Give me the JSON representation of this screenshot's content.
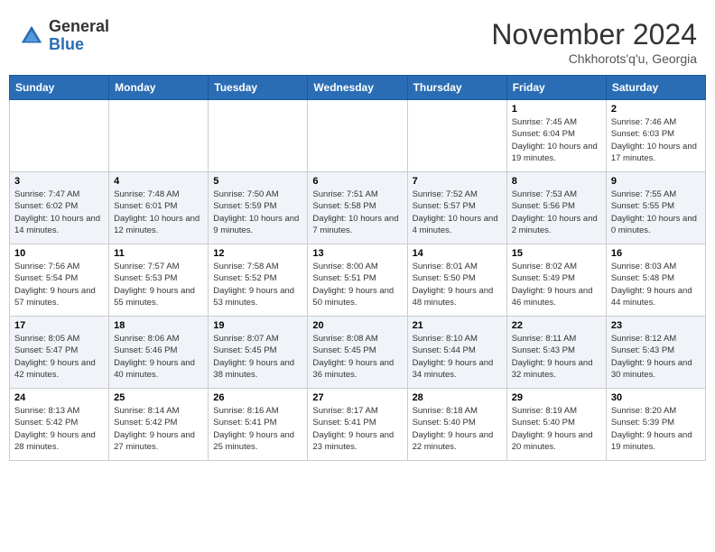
{
  "header": {
    "logo_general": "General",
    "logo_blue": "Blue",
    "month_title": "November 2024",
    "location": "Chkhorots'q'u, Georgia"
  },
  "weekdays": [
    "Sunday",
    "Monday",
    "Tuesday",
    "Wednesday",
    "Thursday",
    "Friday",
    "Saturday"
  ],
  "weeks": [
    [
      {
        "day": "",
        "sunrise": "",
        "sunset": "",
        "daylight": ""
      },
      {
        "day": "",
        "sunrise": "",
        "sunset": "",
        "daylight": ""
      },
      {
        "day": "",
        "sunrise": "",
        "sunset": "",
        "daylight": ""
      },
      {
        "day": "",
        "sunrise": "",
        "sunset": "",
        "daylight": ""
      },
      {
        "day": "",
        "sunrise": "",
        "sunset": "",
        "daylight": ""
      },
      {
        "day": "1",
        "sunrise": "Sunrise: 7:45 AM",
        "sunset": "Sunset: 6:04 PM",
        "daylight": "Daylight: 10 hours and 19 minutes."
      },
      {
        "day": "2",
        "sunrise": "Sunrise: 7:46 AM",
        "sunset": "Sunset: 6:03 PM",
        "daylight": "Daylight: 10 hours and 17 minutes."
      }
    ],
    [
      {
        "day": "3",
        "sunrise": "Sunrise: 7:47 AM",
        "sunset": "Sunset: 6:02 PM",
        "daylight": "Daylight: 10 hours and 14 minutes."
      },
      {
        "day": "4",
        "sunrise": "Sunrise: 7:48 AM",
        "sunset": "Sunset: 6:01 PM",
        "daylight": "Daylight: 10 hours and 12 minutes."
      },
      {
        "day": "5",
        "sunrise": "Sunrise: 7:50 AM",
        "sunset": "Sunset: 5:59 PM",
        "daylight": "Daylight: 10 hours and 9 minutes."
      },
      {
        "day": "6",
        "sunrise": "Sunrise: 7:51 AM",
        "sunset": "Sunset: 5:58 PM",
        "daylight": "Daylight: 10 hours and 7 minutes."
      },
      {
        "day": "7",
        "sunrise": "Sunrise: 7:52 AM",
        "sunset": "Sunset: 5:57 PM",
        "daylight": "Daylight: 10 hours and 4 minutes."
      },
      {
        "day": "8",
        "sunrise": "Sunrise: 7:53 AM",
        "sunset": "Sunset: 5:56 PM",
        "daylight": "Daylight: 10 hours and 2 minutes."
      },
      {
        "day": "9",
        "sunrise": "Sunrise: 7:55 AM",
        "sunset": "Sunset: 5:55 PM",
        "daylight": "Daylight: 10 hours and 0 minutes."
      }
    ],
    [
      {
        "day": "10",
        "sunrise": "Sunrise: 7:56 AM",
        "sunset": "Sunset: 5:54 PM",
        "daylight": "Daylight: 9 hours and 57 minutes."
      },
      {
        "day": "11",
        "sunrise": "Sunrise: 7:57 AM",
        "sunset": "Sunset: 5:53 PM",
        "daylight": "Daylight: 9 hours and 55 minutes."
      },
      {
        "day": "12",
        "sunrise": "Sunrise: 7:58 AM",
        "sunset": "Sunset: 5:52 PM",
        "daylight": "Daylight: 9 hours and 53 minutes."
      },
      {
        "day": "13",
        "sunrise": "Sunrise: 8:00 AM",
        "sunset": "Sunset: 5:51 PM",
        "daylight": "Daylight: 9 hours and 50 minutes."
      },
      {
        "day": "14",
        "sunrise": "Sunrise: 8:01 AM",
        "sunset": "Sunset: 5:50 PM",
        "daylight": "Daylight: 9 hours and 48 minutes."
      },
      {
        "day": "15",
        "sunrise": "Sunrise: 8:02 AM",
        "sunset": "Sunset: 5:49 PM",
        "daylight": "Daylight: 9 hours and 46 minutes."
      },
      {
        "day": "16",
        "sunrise": "Sunrise: 8:03 AM",
        "sunset": "Sunset: 5:48 PM",
        "daylight": "Daylight: 9 hours and 44 minutes."
      }
    ],
    [
      {
        "day": "17",
        "sunrise": "Sunrise: 8:05 AM",
        "sunset": "Sunset: 5:47 PM",
        "daylight": "Daylight: 9 hours and 42 minutes."
      },
      {
        "day": "18",
        "sunrise": "Sunrise: 8:06 AM",
        "sunset": "Sunset: 5:46 PM",
        "daylight": "Daylight: 9 hours and 40 minutes."
      },
      {
        "day": "19",
        "sunrise": "Sunrise: 8:07 AM",
        "sunset": "Sunset: 5:45 PM",
        "daylight": "Daylight: 9 hours and 38 minutes."
      },
      {
        "day": "20",
        "sunrise": "Sunrise: 8:08 AM",
        "sunset": "Sunset: 5:45 PM",
        "daylight": "Daylight: 9 hours and 36 minutes."
      },
      {
        "day": "21",
        "sunrise": "Sunrise: 8:10 AM",
        "sunset": "Sunset: 5:44 PM",
        "daylight": "Daylight: 9 hours and 34 minutes."
      },
      {
        "day": "22",
        "sunrise": "Sunrise: 8:11 AM",
        "sunset": "Sunset: 5:43 PM",
        "daylight": "Daylight: 9 hours and 32 minutes."
      },
      {
        "day": "23",
        "sunrise": "Sunrise: 8:12 AM",
        "sunset": "Sunset: 5:43 PM",
        "daylight": "Daylight: 9 hours and 30 minutes."
      }
    ],
    [
      {
        "day": "24",
        "sunrise": "Sunrise: 8:13 AM",
        "sunset": "Sunset: 5:42 PM",
        "daylight": "Daylight: 9 hours and 28 minutes."
      },
      {
        "day": "25",
        "sunrise": "Sunrise: 8:14 AM",
        "sunset": "Sunset: 5:42 PM",
        "daylight": "Daylight: 9 hours and 27 minutes."
      },
      {
        "day": "26",
        "sunrise": "Sunrise: 8:16 AM",
        "sunset": "Sunset: 5:41 PM",
        "daylight": "Daylight: 9 hours and 25 minutes."
      },
      {
        "day": "27",
        "sunrise": "Sunrise: 8:17 AM",
        "sunset": "Sunset: 5:41 PM",
        "daylight": "Daylight: 9 hours and 23 minutes."
      },
      {
        "day": "28",
        "sunrise": "Sunrise: 8:18 AM",
        "sunset": "Sunset: 5:40 PM",
        "daylight": "Daylight: 9 hours and 22 minutes."
      },
      {
        "day": "29",
        "sunrise": "Sunrise: 8:19 AM",
        "sunset": "Sunset: 5:40 PM",
        "daylight": "Daylight: 9 hours and 20 minutes."
      },
      {
        "day": "30",
        "sunrise": "Sunrise: 8:20 AM",
        "sunset": "Sunset: 5:39 PM",
        "daylight": "Daylight: 9 hours and 19 minutes."
      }
    ]
  ]
}
